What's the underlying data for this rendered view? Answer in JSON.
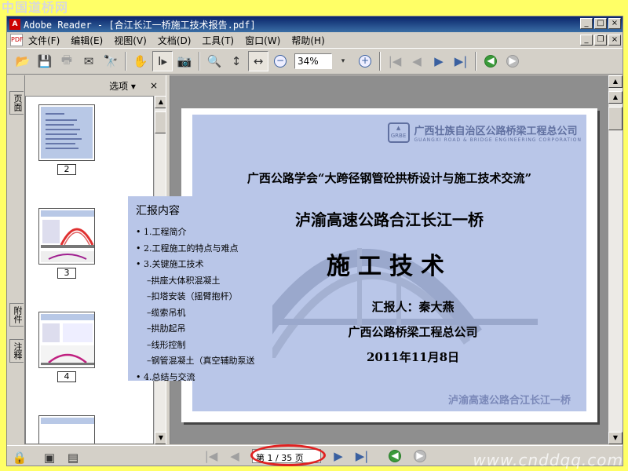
{
  "watermark_top": "中国道桥网",
  "watermark_bottom": "www.cnddqq.com",
  "window": {
    "title": "Adobe Reader - [合江长江一桥施工技术报告.pdf]",
    "app_icon": "adobe-reader-icon",
    "controls": [
      "_",
      "□",
      "×"
    ]
  },
  "menubar": {
    "items": [
      "文件(F)",
      "编辑(E)",
      "视图(V)",
      "文档(D)",
      "工具(T)",
      "窗口(W)",
      "帮助(H)"
    ]
  },
  "toolbar": {
    "zoom_value": "34%",
    "icons": [
      "open-icon",
      "save-icon",
      "print-icon",
      "email-icon",
      "search-icon",
      "hand-icon",
      "select-text-icon",
      "snapshot-icon",
      "zoom-in-icon",
      "fit-height-icon",
      "fit-width-icon",
      "zoom-out-icon",
      "zoom-plus-icon",
      "first-page-icon",
      "prev-page-icon",
      "next-page-icon",
      "last-page-icon",
      "back-icon",
      "forward-icon"
    ]
  },
  "side_tabs": [
    "页面",
    "附件",
    "注释"
  ],
  "panel": {
    "options_label": "选项 ▾",
    "close_label": "×",
    "page_numbers": [
      "2",
      "3",
      "4"
    ]
  },
  "slide": {
    "company_logo_text": "广西壮族自治区公路桥梁工程总公司",
    "company_en": "GUANGXI ROAD & BRIDGE ENGINEERING CORPORATION",
    "association": "广西公路学会“大跨径钢管砼拱桥设计与施工技术交流”",
    "title": "泸渝高速公路合江长江一桥",
    "subtitle": "施工技术",
    "reporter": "汇报人：秦大燕",
    "company": "广西公路桥梁工程总公司",
    "date": "2011年11月8日",
    "footer": "泸渝高速公路合江长江一桥"
  },
  "overlay": {
    "heading": "汇报内容",
    "items": [
      "• 1.工程简介",
      "• 2.工程施工的特点与难点",
      "• 3.关键施工技术",
      "  –拱座大体积混凝土",
      "  –扣塔安装（摇臂抱杆）",
      "  –缆索吊机",
      "  –拱肋起吊",
      "  –线形控制",
      "  –钢管混凝土（真空辅助泵送",
      "• 4.总结与交流"
    ]
  },
  "statusbar": {
    "page_indicator": "第 1 / 35 页"
  },
  "colors": {
    "title_bar": "#0a246a",
    "slide_bg": "#b9c6e8",
    "highlight_ellipse": "#e02020",
    "frame": "#ffff66"
  }
}
